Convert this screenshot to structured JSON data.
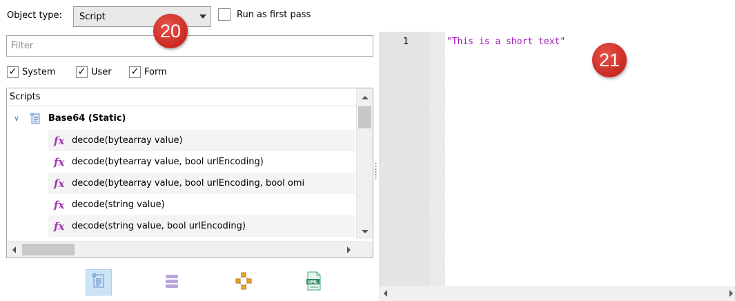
{
  "top_bar": {
    "object_type_label": "Object type:",
    "object_type_value": "Script",
    "run_first_pass_label": "Run as first pass",
    "run_first_pass_checked": false
  },
  "filter": {
    "placeholder": "Filter",
    "value": ""
  },
  "checkboxes": [
    {
      "label": "System",
      "checked": true
    },
    {
      "label": "User",
      "checked": true
    },
    {
      "label": "Form",
      "checked": true
    }
  ],
  "tree": {
    "header": "Scripts",
    "parent": {
      "label": "Base64 (Static)",
      "expanded": true,
      "icon": "script-icon"
    },
    "items": [
      {
        "label": "decode(bytearray value)",
        "icon": "function-icon"
      },
      {
        "label": "decode(bytearray value, bool urlEncoding)",
        "icon": "function-icon"
      },
      {
        "label": "decode(bytearray value, bool urlEncoding, bool omi",
        "icon": "function-icon"
      },
      {
        "label": "decode(string value)",
        "icon": "function-icon"
      },
      {
        "label": "decode(string value, bool urlEncoding)",
        "icon": "function-icon"
      }
    ]
  },
  "toolbar": [
    "script-view-icon",
    "list-view-icon",
    "graph-view-icon",
    "xml-view-icon"
  ],
  "editor": {
    "line_number": "1",
    "code": "\"This is a short text\""
  },
  "callouts": [
    "20",
    "21"
  ],
  "colors": {
    "string_literal": "#a01ab8",
    "fx_icon": "#a22fb4",
    "callout": "#d33a31"
  }
}
